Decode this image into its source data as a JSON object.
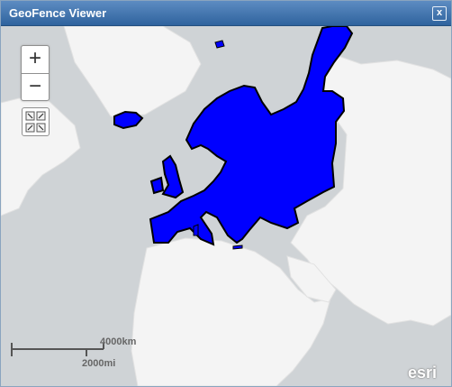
{
  "window": {
    "title": "GeoFence Viewer",
    "close_label": "x"
  },
  "zoom": {
    "in_label": "+",
    "out_label": "−"
  },
  "scale": {
    "km_label": "4000km",
    "mi_label": "2000mi"
  },
  "attribution": {
    "logo_text": "esri"
  },
  "colors": {
    "geofence_fill": "#0000ff",
    "geofence_stroke": "#000000",
    "water": "#cfd3d6",
    "land": "#f4f4f4"
  }
}
